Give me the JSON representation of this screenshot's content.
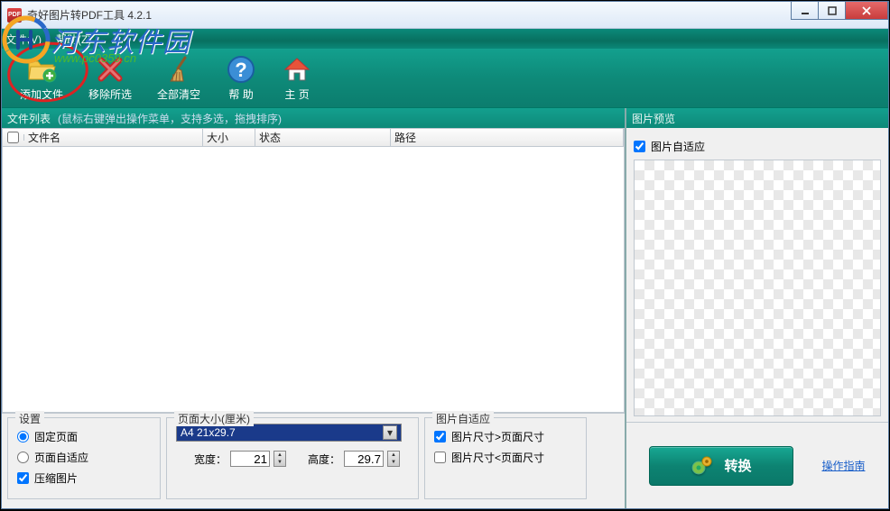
{
  "title": "奇好图片转PDF工具 4.2.1",
  "menu": {
    "file": "文件(V)",
    "help": "帮助(Z)"
  },
  "toolbar": {
    "add": "添加文件",
    "remove": "移除所选",
    "clear": "全部清空",
    "help": "帮 助",
    "home": "主 页"
  },
  "list": {
    "title": "文件列表",
    "hint": "(鼠标右键弹出操作菜单，支持多选，拖拽排序)",
    "cols": {
      "name": "文件名",
      "size": "大小",
      "status": "状态",
      "path": "路径"
    }
  },
  "settings": {
    "title": "设置",
    "fixed": "固定页面",
    "auto": "页面自适应",
    "compress": "压缩图片",
    "page": {
      "title": "页面大小(厘米)",
      "preset": "A4        21x29.7",
      "wlabel": "宽度：",
      "wval": "21",
      "hlabel": "高度：",
      "hval": "29.7"
    },
    "imgauto": {
      "title": "图片自适应",
      "gt": "图片尺寸>页面尺寸",
      "lt": "图片尺寸<页面尺寸"
    }
  },
  "preview": {
    "title": "图片预览",
    "autofit": "图片自适应"
  },
  "action": {
    "convert": "转换",
    "guide": "操作指南"
  },
  "watermark": {
    "text": "河东软件园",
    "url": "www.pc0359.cn"
  }
}
